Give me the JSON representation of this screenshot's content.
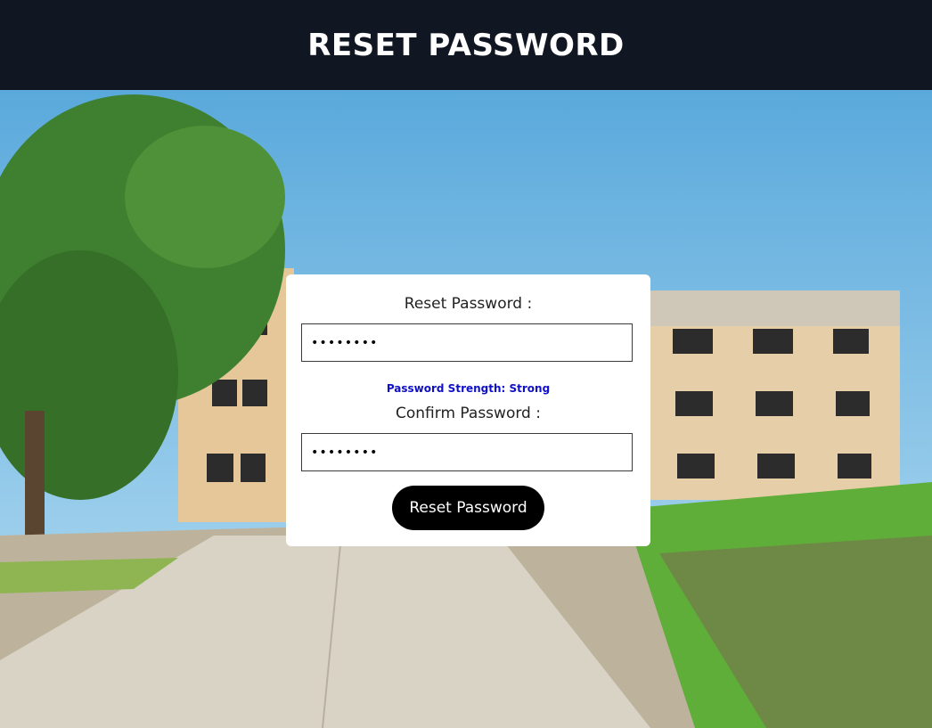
{
  "header": {
    "title": "RESET PASSWORD"
  },
  "form": {
    "reset_label": "Reset Password :",
    "password_value": "••••••••",
    "strength_text": "Password Strength: Strong",
    "confirm_label": "Confirm Password :",
    "confirm_value": "••••••••",
    "submit_label": "Reset Password"
  },
  "colors": {
    "header_bg": "#111722",
    "strength": "#1010c8",
    "button_bg": "#000000"
  }
}
